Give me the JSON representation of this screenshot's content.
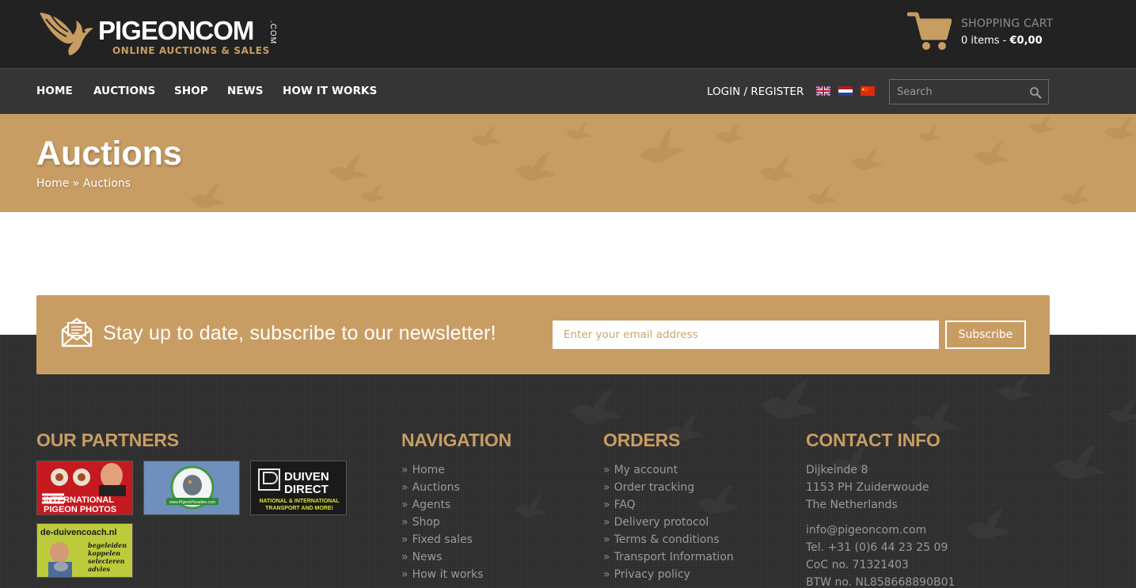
{
  "header": {
    "logo": {
      "name": "PIGEONCOM",
      "suffix": ".COM",
      "tagline": "ONLINE AUCTIONS & SALES"
    },
    "cart": {
      "title": "SHOPPING CART",
      "items_label": "0 items - ",
      "total": "€0,00",
      "icon": "shopping-cart-icon"
    }
  },
  "nav": {
    "items": [
      {
        "label": "HOME"
      },
      {
        "label": "AUCTIONS"
      },
      {
        "label": "SHOP"
      },
      {
        "label": "NEWS"
      },
      {
        "label": "HOW IT WORKS"
      }
    ],
    "login_label": "LOGIN / REGISTER",
    "languages": [
      "English",
      "Dutch",
      "Chinese"
    ],
    "search_placeholder": "Search"
  },
  "hero": {
    "title": "Auctions",
    "breadcrumb": {
      "home": "Home",
      "separator": " » ",
      "current": "Auctions"
    }
  },
  "newsletter": {
    "text": "Stay up to date, subscribe to our newsletter!",
    "email_placeholder": "Enter your email address",
    "button_label": "Subscribe"
  },
  "footer": {
    "partners": {
      "title": "OUR PARTNERS",
      "items": [
        {
          "name": "International Pigeon Photos",
          "lines": [
            "INTERNATIONAL",
            "PIGEON PHOTOS"
          ]
        },
        {
          "name": "PigeonParadise",
          "lines": [
            "www.PigeonParadise.com"
          ]
        },
        {
          "name": "Duiven Direct",
          "lines": [
            "DUIVEN",
            "DIRECT",
            "NATIONAL & INTERNATIONAL",
            "TRANSPORT AND MORE!"
          ]
        },
        {
          "name": "de-duivencoach.nl",
          "lines": [
            "de-duivencoach.nl",
            "begeleiden",
            "koppelen",
            "selecteren",
            "advies"
          ]
        }
      ]
    },
    "navigation": {
      "title": "NAVIGATION",
      "links": [
        "Home",
        "Auctions",
        "Agents",
        "Shop",
        "Fixed sales",
        "News",
        "How it works"
      ]
    },
    "orders": {
      "title": "ORDERS",
      "links": [
        "My account",
        "Order tracking",
        "FAQ",
        "Delivery protocol",
        "Terms & conditions",
        "Transport Information",
        "Privacy policy"
      ]
    },
    "contact": {
      "title": "CONTACT INFO",
      "address": [
        "Dijkeinde 8",
        "1153 PH Zuiderwoude",
        "The Netherlands"
      ],
      "email": "info@pigeoncom.com",
      "phone": "Tel. +31 (0)6 44 23 25 09",
      "coc": "CoC no. 71321403",
      "btw": "BTW no. NL858668890B01"
    }
  },
  "colors": {
    "accent": "#c89d64",
    "header_bg": "#232222",
    "nav_bg": "#363535",
    "footer_bg": "#2d2c2c"
  }
}
